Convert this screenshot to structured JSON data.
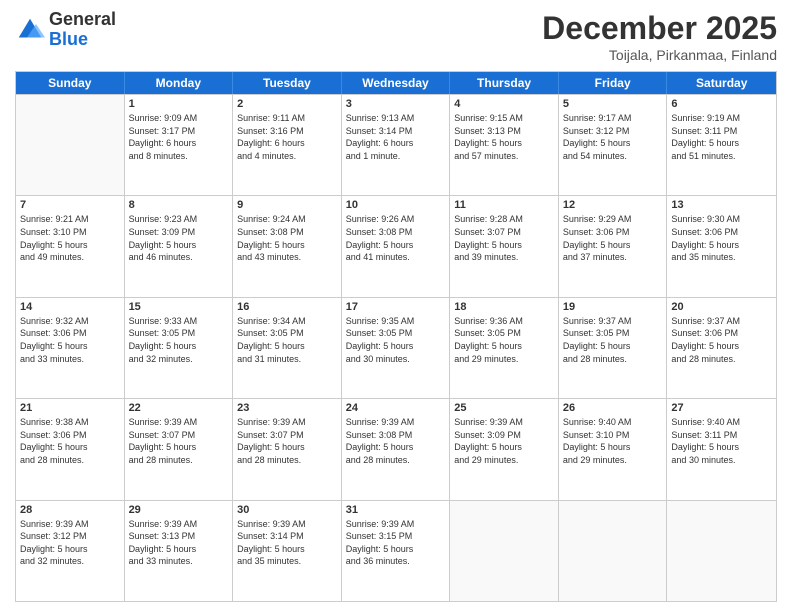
{
  "header": {
    "logo_general": "General",
    "logo_blue": "Blue",
    "month_title": "December 2025",
    "subtitle": "Toijala, Pirkanmaa, Finland"
  },
  "day_headers": [
    "Sunday",
    "Monday",
    "Tuesday",
    "Wednesday",
    "Thursday",
    "Friday",
    "Saturday"
  ],
  "weeks": [
    [
      {
        "date": "",
        "info": ""
      },
      {
        "date": "1",
        "info": "Sunrise: 9:09 AM\nSunset: 3:17 PM\nDaylight: 6 hours\nand 8 minutes."
      },
      {
        "date": "2",
        "info": "Sunrise: 9:11 AM\nSunset: 3:16 PM\nDaylight: 6 hours\nand 4 minutes."
      },
      {
        "date": "3",
        "info": "Sunrise: 9:13 AM\nSunset: 3:14 PM\nDaylight: 6 hours\nand 1 minute."
      },
      {
        "date": "4",
        "info": "Sunrise: 9:15 AM\nSunset: 3:13 PM\nDaylight: 5 hours\nand 57 minutes."
      },
      {
        "date": "5",
        "info": "Sunrise: 9:17 AM\nSunset: 3:12 PM\nDaylight: 5 hours\nand 54 minutes."
      },
      {
        "date": "6",
        "info": "Sunrise: 9:19 AM\nSunset: 3:11 PM\nDaylight: 5 hours\nand 51 minutes."
      }
    ],
    [
      {
        "date": "7",
        "info": "Sunrise: 9:21 AM\nSunset: 3:10 PM\nDaylight: 5 hours\nand 49 minutes."
      },
      {
        "date": "8",
        "info": "Sunrise: 9:23 AM\nSunset: 3:09 PM\nDaylight: 5 hours\nand 46 minutes."
      },
      {
        "date": "9",
        "info": "Sunrise: 9:24 AM\nSunset: 3:08 PM\nDaylight: 5 hours\nand 43 minutes."
      },
      {
        "date": "10",
        "info": "Sunrise: 9:26 AM\nSunset: 3:08 PM\nDaylight: 5 hours\nand 41 minutes."
      },
      {
        "date": "11",
        "info": "Sunrise: 9:28 AM\nSunset: 3:07 PM\nDaylight: 5 hours\nand 39 minutes."
      },
      {
        "date": "12",
        "info": "Sunrise: 9:29 AM\nSunset: 3:06 PM\nDaylight: 5 hours\nand 37 minutes."
      },
      {
        "date": "13",
        "info": "Sunrise: 9:30 AM\nSunset: 3:06 PM\nDaylight: 5 hours\nand 35 minutes."
      }
    ],
    [
      {
        "date": "14",
        "info": "Sunrise: 9:32 AM\nSunset: 3:06 PM\nDaylight: 5 hours\nand 33 minutes."
      },
      {
        "date": "15",
        "info": "Sunrise: 9:33 AM\nSunset: 3:05 PM\nDaylight: 5 hours\nand 32 minutes."
      },
      {
        "date": "16",
        "info": "Sunrise: 9:34 AM\nSunset: 3:05 PM\nDaylight: 5 hours\nand 31 minutes."
      },
      {
        "date": "17",
        "info": "Sunrise: 9:35 AM\nSunset: 3:05 PM\nDaylight: 5 hours\nand 30 minutes."
      },
      {
        "date": "18",
        "info": "Sunrise: 9:36 AM\nSunset: 3:05 PM\nDaylight: 5 hours\nand 29 minutes."
      },
      {
        "date": "19",
        "info": "Sunrise: 9:37 AM\nSunset: 3:05 PM\nDaylight: 5 hours\nand 28 minutes."
      },
      {
        "date": "20",
        "info": "Sunrise: 9:37 AM\nSunset: 3:06 PM\nDaylight: 5 hours\nand 28 minutes."
      }
    ],
    [
      {
        "date": "21",
        "info": "Sunrise: 9:38 AM\nSunset: 3:06 PM\nDaylight: 5 hours\nand 28 minutes."
      },
      {
        "date": "22",
        "info": "Sunrise: 9:39 AM\nSunset: 3:07 PM\nDaylight: 5 hours\nand 28 minutes."
      },
      {
        "date": "23",
        "info": "Sunrise: 9:39 AM\nSunset: 3:07 PM\nDaylight: 5 hours\nand 28 minutes."
      },
      {
        "date": "24",
        "info": "Sunrise: 9:39 AM\nSunset: 3:08 PM\nDaylight: 5 hours\nand 28 minutes."
      },
      {
        "date": "25",
        "info": "Sunrise: 9:39 AM\nSunset: 3:09 PM\nDaylight: 5 hours\nand 29 minutes."
      },
      {
        "date": "26",
        "info": "Sunrise: 9:40 AM\nSunset: 3:10 PM\nDaylight: 5 hours\nand 29 minutes."
      },
      {
        "date": "27",
        "info": "Sunrise: 9:40 AM\nSunset: 3:11 PM\nDaylight: 5 hours\nand 30 minutes."
      }
    ],
    [
      {
        "date": "28",
        "info": "Sunrise: 9:39 AM\nSunset: 3:12 PM\nDaylight: 5 hours\nand 32 minutes."
      },
      {
        "date": "29",
        "info": "Sunrise: 9:39 AM\nSunset: 3:13 PM\nDaylight: 5 hours\nand 33 minutes."
      },
      {
        "date": "30",
        "info": "Sunrise: 9:39 AM\nSunset: 3:14 PM\nDaylight: 5 hours\nand 35 minutes."
      },
      {
        "date": "31",
        "info": "Sunrise: 9:39 AM\nSunset: 3:15 PM\nDaylight: 5 hours\nand 36 minutes."
      },
      {
        "date": "",
        "info": ""
      },
      {
        "date": "",
        "info": ""
      },
      {
        "date": "",
        "info": ""
      }
    ]
  ]
}
